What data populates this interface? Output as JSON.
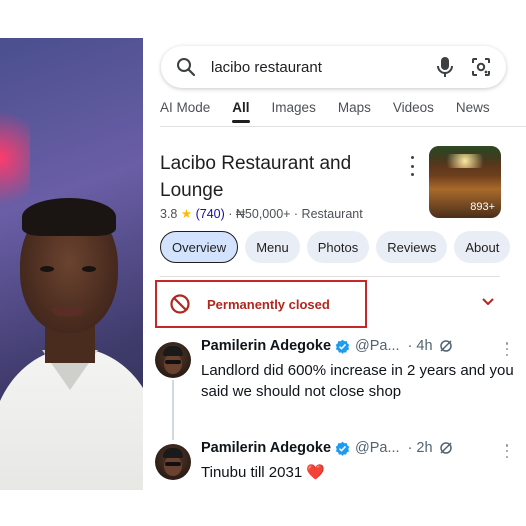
{
  "search": {
    "query": "lacibo restaurant"
  },
  "icons": {
    "search": "search-icon",
    "mic": "mic-icon",
    "lens": "lens-icon",
    "more": "more-vert-icon",
    "ban": "ban-icon",
    "chevron": "chevron-down-icon",
    "verified": "verified-badge-icon",
    "grok": "grok-icon"
  },
  "tabs": [
    "AI Mode",
    "All",
    "Images",
    "Maps",
    "Videos",
    "News"
  ],
  "place": {
    "title": "Lacibo Restaurant and Lounge",
    "rating": "3.8",
    "star": "★",
    "reviews": "(740)",
    "price_and_type": "· ₦50,000+ · Restaurant",
    "photo_count": "893+"
  },
  "chips": [
    "Overview",
    "Menu",
    "Photos",
    "Reviews",
    "About"
  ],
  "status": {
    "label": "Permanently closed",
    "color": "#c62828"
  },
  "tweets": [
    {
      "name": "Pamilerin Adegoke",
      "handle": "@Pa...",
      "time": "· 4h",
      "text": "Landlord did 600% increase in 2 years and you said we should not close shop"
    },
    {
      "name": "Pamilerin Adegoke",
      "handle": "@Pa...",
      "time": "· 2h",
      "text": "Tinubu till 2031",
      "emoji": "❤️"
    }
  ],
  "colors": {
    "accent": "#1a73e8",
    "chip_bg": "#e9eef6",
    "chip_active_bg": "#d3e3fd",
    "closed_red": "#c62828",
    "verified_blue": "#1d9bf0"
  }
}
